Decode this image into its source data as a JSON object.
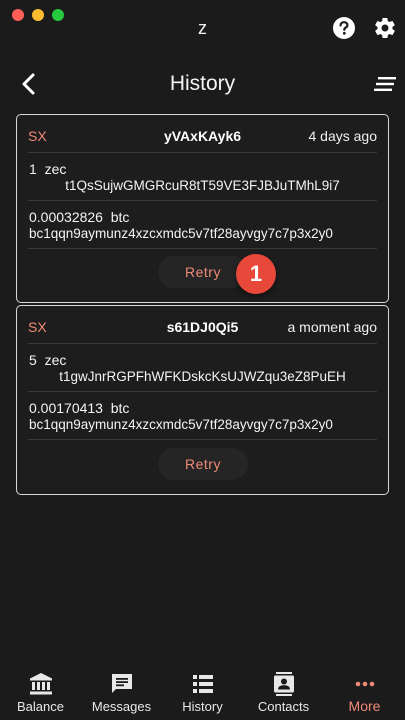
{
  "window": {
    "title": "z"
  },
  "header": {
    "title": "History"
  },
  "transactions": [
    {
      "tag": "SX",
      "id": "yVAxKAyk6",
      "when": "4 days ago",
      "from_amount": "1  zec",
      "from_address": "t1QsSujwGMGRcuR8tT59VE3FJBJuTMhL9i7",
      "to_amount": "0.00032826  btc",
      "to_address": "bc1qqn9aymunz4xzcxmdc5v7tf28ayvgy7c7p3x2y0",
      "action": "Retry",
      "badge": "1"
    },
    {
      "tag": "SX",
      "id": "s61DJ0Qi5",
      "when": "a moment ago",
      "from_amount": "5  zec",
      "from_address": "t1gwJnrRGPFhWFKDskcKsUJWZqu3eZ8PuEH",
      "to_amount": "0.00170413  btc",
      "to_address": "bc1qqn9aymunz4xzcxmdc5v7tf28ayvgy7c7p3x2y0",
      "action": "Retry"
    }
  ],
  "nav": {
    "items": [
      {
        "label": "Balance",
        "icon": "bank-icon"
      },
      {
        "label": "Messages",
        "icon": "chat-icon"
      },
      {
        "label": "History",
        "icon": "list-icon"
      },
      {
        "label": "Contacts",
        "icon": "contacts-icon"
      },
      {
        "label": "More",
        "icon": "more-icon",
        "active": true
      }
    ]
  },
  "colors": {
    "accent": "#f08a78",
    "background": "#1c1b1b",
    "badge": "#e8483a"
  }
}
